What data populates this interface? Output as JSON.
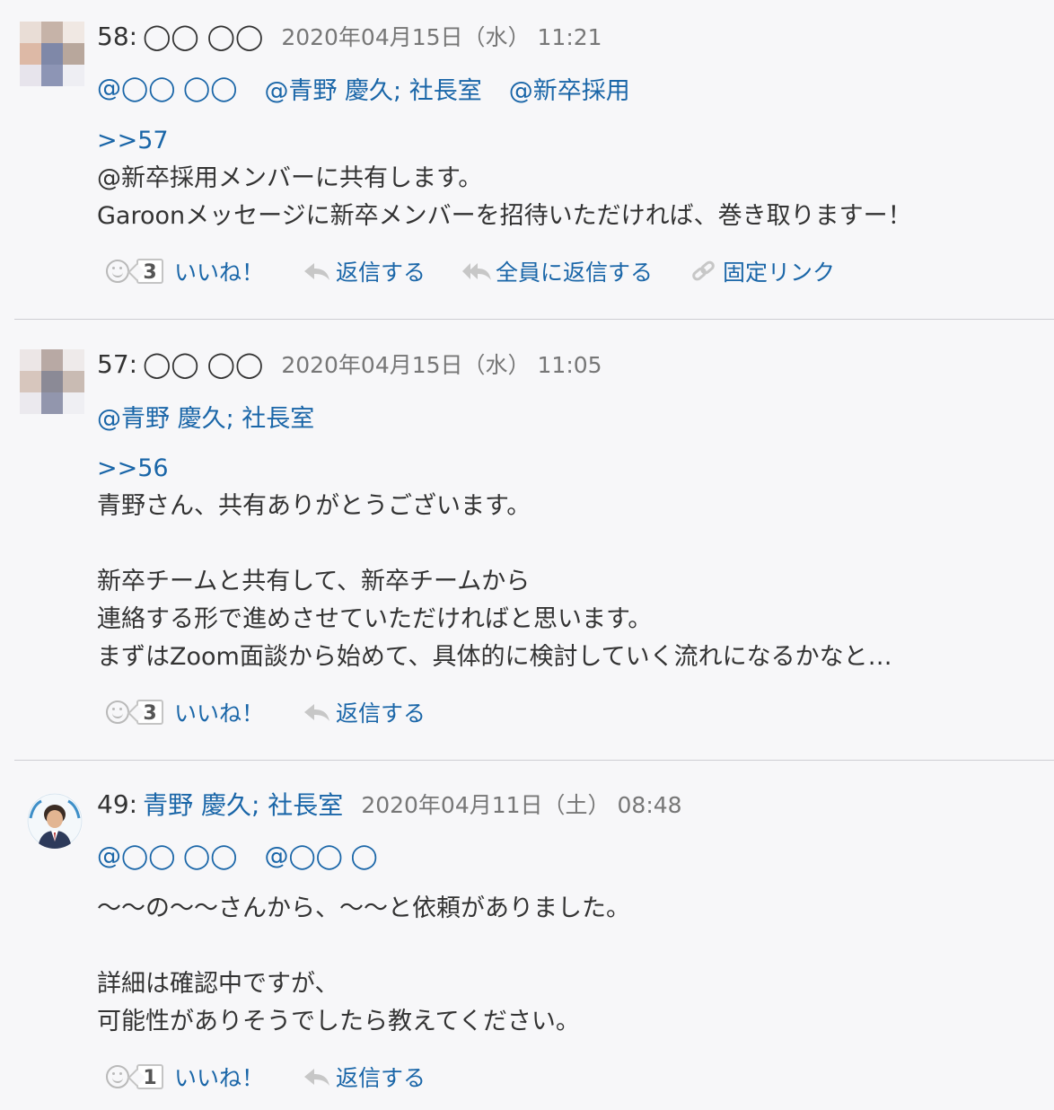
{
  "posts": [
    {
      "number": "58:",
      "author": "◯◯ ◯◯",
      "timestamp": "2020年04月15日（水） 11:21",
      "mentions": [
        "@◯◯ ◯◯",
        "@青野 慶久; 社長室",
        "@新卒採用"
      ],
      "reply_to": ">>57",
      "lines": [
        "@新卒採用メンバーに共有します。",
        "Garoonメッセージに新卒メンバーを招待いただければ、巻き取りますー！"
      ],
      "like_count": "3",
      "like_label": "いいね！",
      "reply_label": "返信する",
      "reply_all_label": "全員に返信する",
      "permalink_label": "固定リンク"
    },
    {
      "number": "57:",
      "author": "◯◯ ◯◯",
      "timestamp": "2020年04月15日（水） 11:05",
      "mentions": [
        "@青野 慶久; 社長室"
      ],
      "reply_to": ">>56",
      "lines": [
        "青野さん、共有ありがとうございます。",
        "",
        "新卒チームと共有して、新卒チームから",
        "連絡する形で進めさせていただければと思います。",
        "まずはZoom面談から始めて、具体的に検討していく流れになるかなと…"
      ],
      "like_count": "3",
      "like_label": "いいね！",
      "reply_label": "返信する"
    },
    {
      "number": "49:",
      "author": "青野 慶久; 社長室",
      "timestamp": "2020年04月11日（土） 08:48",
      "mentions": [
        "@◯◯ ◯◯",
        "@◯◯ ◯"
      ],
      "lines": [
        "〜〜の〜〜さんから、〜〜と依頼がありました。",
        "",
        "詳細は確認中ですが、",
        "可能性がありそうでしたら教えてください。"
      ],
      "like_count": "1",
      "like_label": "いいね！",
      "reply_label": "返信する"
    }
  ],
  "colors": {
    "link": "#1a66a8",
    "text": "#333333",
    "muted": "#777777",
    "background": "#f7f7f9"
  },
  "icons": {
    "like": "smile-icon",
    "reply": "reply-arrow-icon",
    "reply_all": "reply-all-icon",
    "permalink": "link-chain-icon"
  }
}
